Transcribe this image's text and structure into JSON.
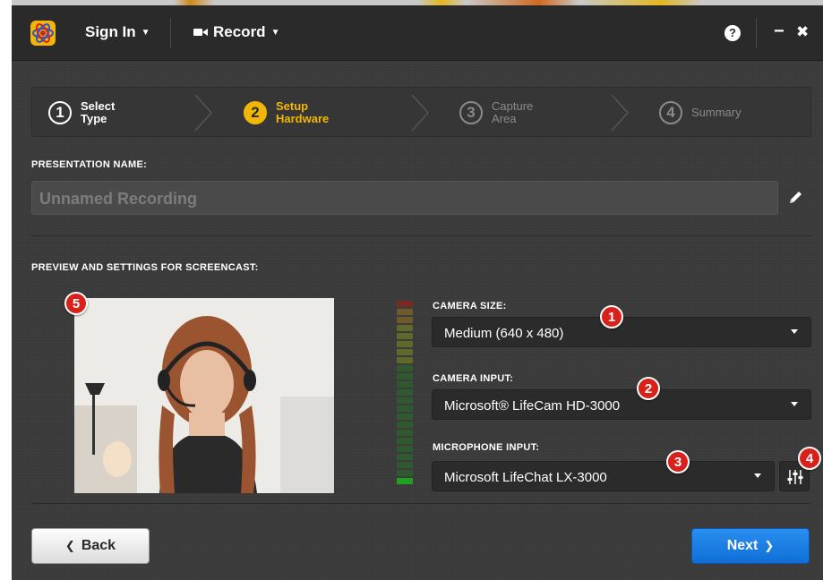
{
  "titlebar": {
    "sign_in": "Sign In",
    "record": "Record",
    "help": "?",
    "minimize": "−",
    "close": "✖"
  },
  "steps": [
    {
      "number": "1",
      "line1": "Select",
      "line2": "Type",
      "state": "done"
    },
    {
      "number": "2",
      "line1": "Setup",
      "line2": "Hardware",
      "state": "active"
    },
    {
      "number": "3",
      "line1": "Capture",
      "line2": "Area",
      "state": "pending"
    },
    {
      "number": "4",
      "line1": "Summary",
      "line2": "",
      "state": "pending"
    }
  ],
  "presentation": {
    "label": "PRESENTATION NAME:",
    "value": "Unnamed Recording"
  },
  "preview": {
    "label": "PREVIEW AND SETTINGS FOR SCREENCAST:"
  },
  "camera_size": {
    "label": "CAMERA SIZE:",
    "value": "Medium (640 x 480)"
  },
  "camera_input": {
    "label": "CAMERA INPUT:",
    "value": "Microsoft® LifeCam HD-3000"
  },
  "microphone_input": {
    "label": "MICROPHONE INPUT:",
    "value": "Microsoft LifeChat LX-3000"
  },
  "badges": [
    "1",
    "2",
    "3",
    "4",
    "5"
  ],
  "buttons": {
    "back": "Back",
    "next": "Next"
  },
  "colors": {
    "accent": "#f2b705",
    "primary": "#0f6ed6",
    "badge": "#d8211a",
    "background": "#3a3a3a"
  },
  "meter": {
    "segments": 23,
    "lit_from_bottom": 1
  }
}
